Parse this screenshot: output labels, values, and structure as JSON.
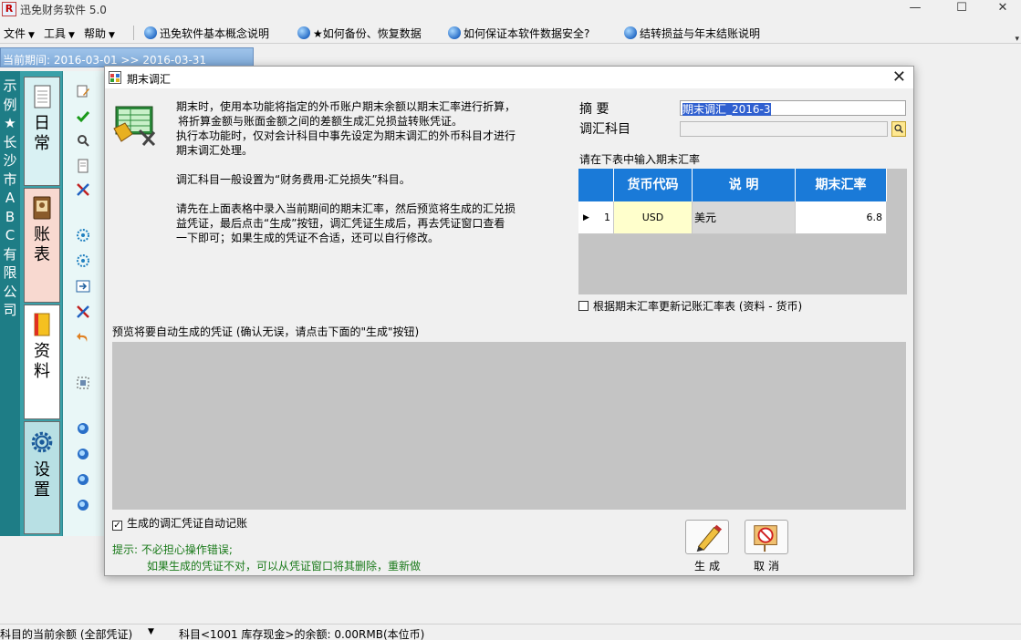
{
  "app": {
    "logo_text": "R",
    "title": "迅免财务软件 5.0",
    "window_controls": {
      "minimize": "—",
      "maximize": "☐",
      "close": "✕"
    }
  },
  "menubar": {
    "menus": [
      {
        "label": "文件"
      },
      {
        "label": "工具"
      },
      {
        "label": "帮助"
      }
    ],
    "help_links": [
      {
        "label": "迅免软件基本概念说明"
      },
      {
        "label": "★如何备份、恢复数据"
      },
      {
        "label": "如何保证本软件数据安全?"
      },
      {
        "label": "结转损益与年末结账说明"
      }
    ]
  },
  "period": {
    "label": "当前期间: 2016-03-01 >> 2016-03-31"
  },
  "sidebar": {
    "company_chars": [
      "示",
      "例",
      "★",
      "长",
      "沙",
      "市",
      "A",
      "B",
      "C",
      "有",
      "限",
      "公",
      "司"
    ],
    "tabs": [
      {
        "label_line1": "日",
        "label_line2": "常",
        "icon": "notebook-icon"
      },
      {
        "label_line1": "账",
        "label_line2": "表",
        "icon": "ledger-book-icon"
      },
      {
        "label_line1": "资",
        "label_line2": "料",
        "icon": "data-book-icon"
      },
      {
        "label_line1": "设",
        "label_line2": "置",
        "icon": "gear-icon"
      }
    ]
  },
  "status": {
    "left": "科目的当前余额 (全部凭证)",
    "right": "科目<1001 库存现金>的余额: 0.00RMB(本位币)"
  },
  "dialog": {
    "title": "期末调汇",
    "close": "✕",
    "instructions": [
      "期末时，使用本功能将指定的外币账户期末余额以期末汇率进行折算，",
      "将折算金额与账面金额之间的差额生成汇兑损益转账凭证。",
      "执行本功能时，仅对会计科目中事先设定为期末调汇的外币科目才进行",
      "期末调汇处理。",
      "",
      "调汇科目一般设置为“财务费用-汇兑损失”科目。",
      "",
      "请先在上面表格中录入当前期间的期末汇率，然后预览将生成的汇兑损",
      "益凭证，最后点击“生成”按钮，调汇凭证生成后，再去凭证窗口查看",
      "一下即可；如果生成的凭证不合适，还可以自行修改。"
    ],
    "summary_label": "摘 要",
    "summary_value": "期末调汇_2016-3",
    "account_label": "调汇科目",
    "account_value": "",
    "rate_prompt": "请在下表中输入期末汇率",
    "rate_table": {
      "headers": [
        "货币代码",
        "说 明",
        "期末汇率"
      ],
      "rows": [
        {
          "indicator": "▶",
          "row_no": "1",
          "currency_code": "USD",
          "description": "美元",
          "rate": "6.8"
        }
      ]
    },
    "update_rate_checkbox": {
      "label": "根据期末汇率更新记账汇率表 (资料 - 货币)",
      "checked": false
    },
    "preview_label": "预览将要自动生成的凭证 (确认无误，请点击下面的\"生成\"按钮)",
    "auto_post_checkbox": {
      "label": "生成的调汇凭证自动记账",
      "checked": true
    },
    "tip_line1": "提示: 不必担心操作错误;",
    "tip_line2": "如果生成的凭证不对，可以从凭证窗口将其删除，重新做",
    "buttons": {
      "generate": "生成",
      "cancel": "取消"
    }
  },
  "colors": {
    "sidebar_teal": "#1e7d86",
    "grid_header_blue": "#1a7ad8",
    "currency_cell_yellow": "#ffffcc",
    "tip_green": "#1a7a1a"
  }
}
